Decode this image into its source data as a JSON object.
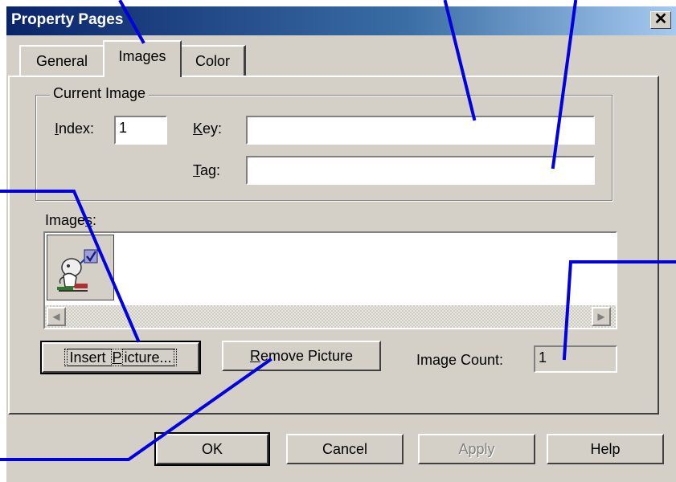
{
  "window": {
    "title": "Property Pages",
    "close_glyph": "✕"
  },
  "tabs": [
    {
      "label": "General"
    },
    {
      "label": "Images"
    },
    {
      "label": "Color"
    }
  ],
  "current_image": {
    "group_label": "Current Image",
    "index_label_mnemonic": "I",
    "index_label_rest": "ndex:",
    "index_value": "1",
    "key_label_mnemonic": "K",
    "key_label_rest": "ey:",
    "key_value": "",
    "tag_label_mnemonic": "T",
    "tag_label_rest": "ag:",
    "tag_value": ""
  },
  "images": {
    "label_rest": "Image",
    "label_mnemonic": "s",
    "label_colon": ":",
    "thumbnail_icon": "picture-wizard-icon",
    "scroll_left_glyph": "◀",
    "scroll_right_glyph": "▶"
  },
  "actions": {
    "insert_rest1": "Insert ",
    "insert_mnemonic": "P",
    "insert_rest2": "icture...",
    "remove_mnemonic": "R",
    "remove_rest": "emove Picture",
    "image_count_label": "Image Count:",
    "image_count_value": "1"
  },
  "footer": {
    "ok": "OK",
    "cancel": "Cancel",
    "apply": "Apply",
    "help": "Help"
  },
  "colors": {
    "annotation_line": "#0000e0",
    "titlebar_start": "#0a246a",
    "dialog_face": "#d4d0c8"
  }
}
